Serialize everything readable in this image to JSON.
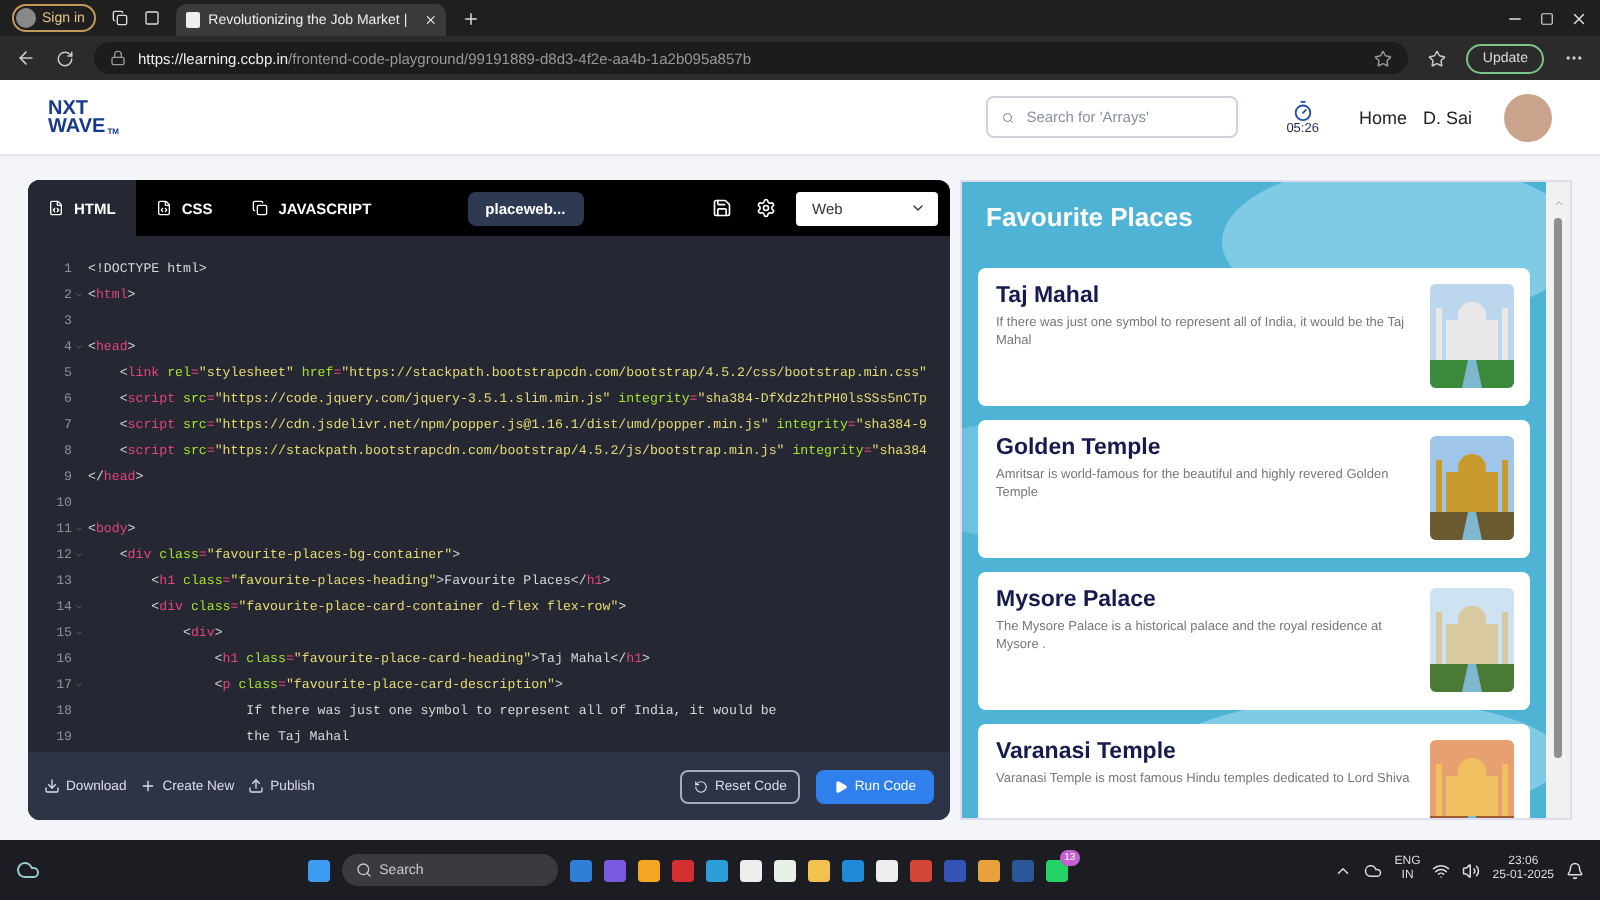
{
  "browser": {
    "profile": "Sign in",
    "tab_title": "Revolutionizing the Job Market |",
    "url_host": "https://learning.ccbp.in",
    "url_path": "/frontend-code-playground/99191889-d8d3-4f2e-aa4b-1a2b095a857b",
    "update": "Update"
  },
  "header": {
    "logo_top": "NXT",
    "logo_bottom": "WAVE",
    "logo_mark": "TM",
    "search": {
      "placeholder": "Search for 'Arrays'"
    },
    "timer": "05:26",
    "nav": "Home",
    "user": "D. Sai"
  },
  "editor": {
    "tabs": [
      {
        "label": "HTML",
        "selected": true
      },
      {
        "label": "CSS",
        "selected": false
      },
      {
        "label": "JAVASCRIPT",
        "selected": false
      }
    ],
    "file_name": "placeweb...",
    "mode": "Web",
    "lines": [
      {
        "num": "1",
        "fold": false,
        "tokens": [
          {
            "kind": "plain",
            "text": "<!DOCTYPE html>"
          }
        ]
      },
      {
        "num": "2",
        "fold": true,
        "tokens": [
          {
            "kind": "plain",
            "text": "<"
          },
          {
            "kind": "tag",
            "text": "html"
          },
          {
            "kind": "plain",
            "text": ">"
          }
        ]
      },
      {
        "num": "3",
        "fold": false
      },
      {
        "num": "4",
        "fold": true,
        "tokens": [
          {
            "kind": "plain",
            "text": "<"
          },
          {
            "kind": "tag",
            "text": "head"
          },
          {
            "kind": "plain",
            "text": ">"
          }
        ]
      },
      {
        "num": "5",
        "fold": false,
        "tokens": [
          {
            "kind": "plain",
            "text": "    <"
          },
          {
            "kind": "tag",
            "text": "link"
          },
          {
            "kind": "attr",
            "text": " rel"
          },
          {
            "kind": "tag",
            "text": "="
          },
          {
            "kind": "string",
            "text": "\"stylesheet\""
          },
          {
            "kind": "attr",
            "text": " href"
          },
          {
            "kind": "tag",
            "text": "="
          },
          {
            "kind": "string",
            "text": "\"https://stackpath.bootstrapcdn.com/bootstrap/4.5.2/css/bootstrap.min.css\""
          }
        ]
      },
      {
        "num": "6",
        "fold": false,
        "tokens": [
          {
            "kind": "plain",
            "text": "    <"
          },
          {
            "kind": "tag",
            "text": "script"
          },
          {
            "kind": "attr",
            "text": " src"
          },
          {
            "kind": "tag",
            "text": "="
          },
          {
            "kind": "string",
            "text": "\"https://code.jquery.com/jquery-3.5.1.slim.min.js\""
          },
          {
            "kind": "attr",
            "text": " integrity"
          },
          {
            "kind": "tag",
            "text": "="
          },
          {
            "kind": "string",
            "text": "\"sha384-DfXdz2htPH0lsSSs5nCTp"
          }
        ]
      },
      {
        "num": "7",
        "fold": false,
        "tokens": [
          {
            "kind": "plain",
            "text": "    <"
          },
          {
            "kind": "tag",
            "text": "script"
          },
          {
            "kind": "attr",
            "text": " src"
          },
          {
            "kind": "tag",
            "text": "="
          },
          {
            "kind": "string",
            "text": "\"https://cdn.jsdelivr.net/npm/popper.js@1.16.1/dist/umd/popper.min.js\""
          },
          {
            "kind": "attr",
            "text": " integrity"
          },
          {
            "kind": "tag",
            "text": "="
          },
          {
            "kind": "string",
            "text": "\"sha384-9"
          }
        ]
      },
      {
        "num": "8",
        "fold": false,
        "tokens": [
          {
            "kind": "plain",
            "text": "    <"
          },
          {
            "kind": "tag",
            "text": "script"
          },
          {
            "kind": "attr",
            "text": " src"
          },
          {
            "kind": "tag",
            "text": "="
          },
          {
            "kind": "string",
            "text": "\"https://stackpath.bootstrapcdn.com/bootstrap/4.5.2/js/bootstrap.min.js\""
          },
          {
            "kind": "attr",
            "text": " integrity"
          },
          {
            "kind": "tag",
            "text": "="
          },
          {
            "kind": "string",
            "text": "\"sha384"
          }
        ]
      },
      {
        "num": "9",
        "fold": false,
        "tokens": [
          {
            "kind": "plain",
            "text": "</"
          },
          {
            "kind": "tag",
            "text": "head"
          },
          {
            "kind": "plain",
            "text": ">"
          }
        ]
      },
      {
        "num": "10",
        "fold": false
      },
      {
        "num": "11",
        "fold": true,
        "tokens": [
          {
            "kind": "plain",
            "text": "<"
          },
          {
            "kind": "tag",
            "text": "body"
          },
          {
            "kind": "plain",
            "text": ">"
          }
        ]
      },
      {
        "num": "12",
        "fold": true,
        "tokens": [
          {
            "kind": "plain",
            "text": "    <"
          },
          {
            "kind": "tag",
            "text": "div"
          },
          {
            "kind": "attr",
            "text": " class"
          },
          {
            "kind": "tag",
            "text": "="
          },
          {
            "kind": "string",
            "text": "\"favourite-places-bg-container\""
          },
          {
            "kind": "plain",
            "text": ">"
          }
        ]
      },
      {
        "num": "13",
        "fold": false,
        "tokens": [
          {
            "kind": "plain",
            "text": "        <"
          },
          {
            "kind": "tag",
            "text": "h1"
          },
          {
            "kind": "attr",
            "text": " class"
          },
          {
            "kind": "tag",
            "text": "="
          },
          {
            "kind": "string",
            "text": "\"favourite-places-heading\""
          },
          {
            "kind": "plain",
            "text": ">Favourite Places</"
          },
          {
            "kind": "tag",
            "text": "h1"
          },
          {
            "kind": "plain",
            "text": ">"
          }
        ]
      },
      {
        "num": "14",
        "fold": true,
        "tokens": [
          {
            "kind": "plain",
            "text": "        <"
          },
          {
            "kind": "tag",
            "text": "div"
          },
          {
            "kind": "attr",
            "text": " class"
          },
          {
            "kind": "tag",
            "text": "="
          },
          {
            "kind": "string",
            "text": "\"favourite-place-card-container d-flex flex-row\""
          },
          {
            "kind": "plain",
            "text": ">"
          }
        ]
      },
      {
        "num": "15",
        "fold": true,
        "tokens": [
          {
            "kind": "plain",
            "text": "            <"
          },
          {
            "kind": "tag",
            "text": "div"
          },
          {
            "kind": "plain",
            "text": ">"
          }
        ]
      },
      {
        "num": "16",
        "fold": false,
        "tokens": [
          {
            "kind": "plain",
            "text": "                <"
          },
          {
            "kind": "tag",
            "text": "h1"
          },
          {
            "kind": "attr",
            "text": " class"
          },
          {
            "kind": "tag",
            "text": "="
          },
          {
            "kind": "string",
            "text": "\"favourite-place-card-heading\""
          },
          {
            "kind": "plain",
            "text": ">Taj Mahal</"
          },
          {
            "kind": "tag",
            "text": "h1"
          },
          {
            "kind": "plain",
            "text": ">"
          }
        ]
      },
      {
        "num": "17",
        "fold": true,
        "tokens": [
          {
            "kind": "plain",
            "text": "                <"
          },
          {
            "kind": "tag",
            "text": "p"
          },
          {
            "kind": "attr",
            "text": " class"
          },
          {
            "kind": "tag",
            "text": "="
          },
          {
            "kind": "string",
            "text": "\"favourite-place-card-description\""
          },
          {
            "kind": "plain",
            "text": ">"
          }
        ]
      },
      {
        "num": "18",
        "fold": false,
        "tokens": [
          {
            "kind": "plain",
            "text": "                    If there was just one symbol to represent all of India, it would be"
          }
        ]
      },
      {
        "num": "19",
        "fold": false,
        "tokens": [
          {
            "kind": "plain",
            "text": "                    the Taj Mahal"
          }
        ]
      }
    ],
    "actions": [
      "Download",
      "Create New",
      "Publish"
    ],
    "reset": "Reset Code",
    "run": "Run Code"
  },
  "preview": {
    "heading": "Favourite Places",
    "cards": [
      {
        "title": "Taj Mahal",
        "description": "If there was just one symbol to represent all of India, it would be the Taj Mahal",
        "kind": "picture"
      },
      {
        "title": "Golden Temple",
        "description": "Amritsar is world-famous for the beautiful and highly revered Golden Temple",
        "kind": "picture"
      },
      {
        "title": "Mysore Palace",
        "description": "The Mysore Palace is a historical palace and the royal residence at Mysore .",
        "kind": "picture"
      },
      {
        "title": "Varanasi Temple",
        "description": "Varanasi Temple is most famous Hindu temples dedicated to Lord Shiva",
        "kind": "picture"
      }
    ]
  },
  "taskbar": {
    "search": "Search",
    "chat_badge": "13",
    "lang_top": "ENG",
    "lang_bottom": "IN",
    "time": "23:06",
    "date": "25-01-2025"
  }
}
